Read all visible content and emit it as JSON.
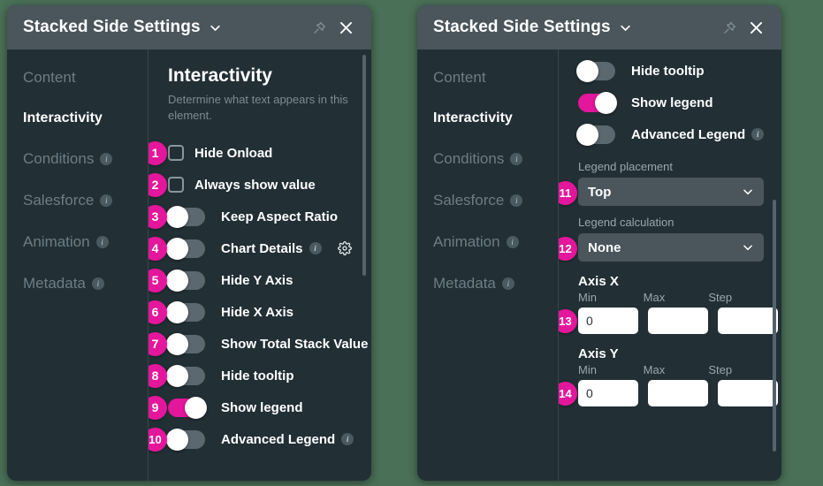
{
  "window": {
    "title": "Stacked Side Settings",
    "caret_icon": "chevron-down-icon",
    "pin_icon": "pin-icon",
    "close_icon": "close-icon"
  },
  "nav": {
    "items": [
      {
        "label": "Content",
        "active": false,
        "info": false
      },
      {
        "label": "Interactivity",
        "active": true,
        "info": false
      },
      {
        "label": "Conditions",
        "active": false,
        "info": true
      },
      {
        "label": "Salesforce",
        "active": false,
        "info": true
      },
      {
        "label": "Animation",
        "active": false,
        "info": true
      },
      {
        "label": "Metadata",
        "active": false,
        "info": true
      }
    ]
  },
  "left_panel": {
    "section_title": "Interactivity",
    "section_subtitle": "Determine what text appears in this element.",
    "controls": [
      {
        "badge": "1",
        "type": "checkbox",
        "label": "Hide Onload",
        "on": false,
        "info": false,
        "gear": false
      },
      {
        "badge": "2",
        "type": "checkbox",
        "label": "Always show value",
        "on": false,
        "info": false,
        "gear": false
      },
      {
        "badge": "3",
        "type": "toggle",
        "label": "Keep Aspect Ratio",
        "on": false,
        "info": false,
        "gear": false
      },
      {
        "badge": "4",
        "type": "toggle",
        "label": "Chart Details",
        "on": false,
        "info": true,
        "gear": true
      },
      {
        "badge": "5",
        "type": "toggle",
        "label": "Hide Y Axis",
        "on": false,
        "info": false,
        "gear": false
      },
      {
        "badge": "6",
        "type": "toggle",
        "label": "Hide X Axis",
        "on": false,
        "info": false,
        "gear": false
      },
      {
        "badge": "7",
        "type": "toggle",
        "label": "Show Total Stack Value",
        "on": false,
        "info": false,
        "gear": false
      },
      {
        "badge": "8",
        "type": "toggle",
        "label": "Hide tooltip",
        "on": false,
        "info": false,
        "gear": false
      },
      {
        "badge": "9",
        "type": "toggle",
        "label": "Show legend",
        "on": true,
        "info": false,
        "gear": false
      },
      {
        "badge": "10",
        "type": "toggle",
        "label": "Advanced Legend",
        "on": false,
        "info": true,
        "gear": false
      }
    ]
  },
  "right_panel": {
    "controls": [
      {
        "badge": "",
        "type": "toggle",
        "label": "Hide tooltip",
        "on": false,
        "info": false
      },
      {
        "badge": "",
        "type": "toggle",
        "label": "Show legend",
        "on": true,
        "info": false
      },
      {
        "badge": "",
        "type": "toggle",
        "label": "Advanced Legend",
        "on": false,
        "info": true
      }
    ],
    "legend_placement": {
      "badge": "11",
      "label": "Legend placement",
      "value": "Top",
      "caret_icon": "chevron-down-icon"
    },
    "legend_calculation": {
      "badge": "12",
      "label": "Legend calculation",
      "value": "None",
      "caret_icon": "chevron-down-icon"
    },
    "axis_x": {
      "badge": "13",
      "title": "Axis X",
      "heads": [
        "Min",
        "Max",
        "Step"
      ],
      "values": [
        "0",
        "",
        ""
      ]
    },
    "axis_y": {
      "badge": "14",
      "title": "Axis Y",
      "heads": [
        "Min",
        "Max",
        "Step"
      ],
      "values": [
        "0",
        "",
        ""
      ]
    }
  },
  "colors": {
    "accent": "#e4169b",
    "panel_bg": "#222f35",
    "titlebar_bg": "#4a565c",
    "page_bg": "#4a7057"
  }
}
